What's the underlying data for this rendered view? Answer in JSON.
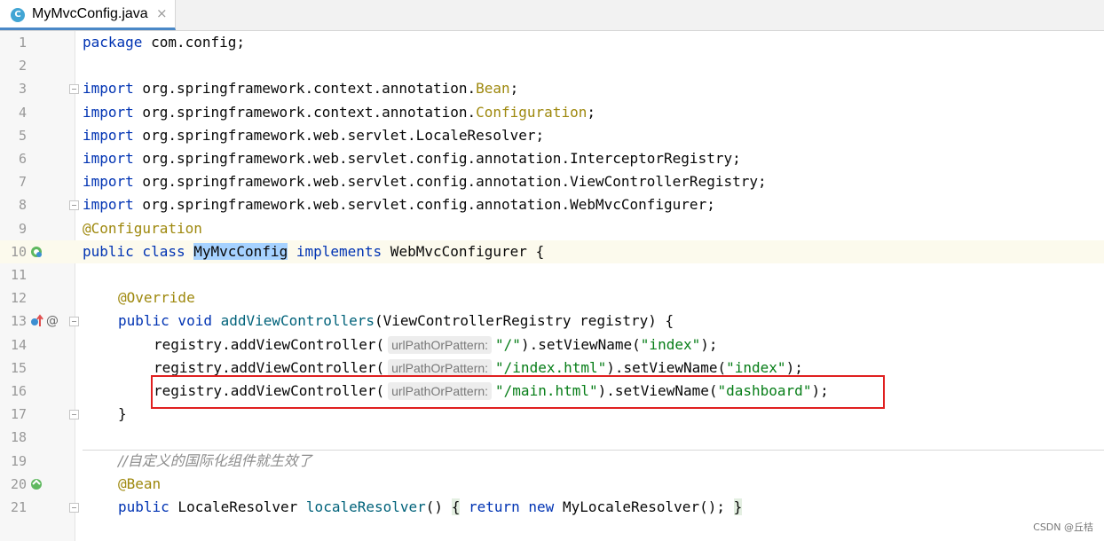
{
  "tab": {
    "icon_letter": "C",
    "title": "MyMvcConfig.java",
    "close_glyph": "×"
  },
  "lines": [
    {
      "n": "1"
    },
    {
      "n": "2"
    },
    {
      "n": "3"
    },
    {
      "n": "4"
    },
    {
      "n": "5"
    },
    {
      "n": "6"
    },
    {
      "n": "7"
    },
    {
      "n": "8"
    },
    {
      "n": "9"
    },
    {
      "n": "10"
    },
    {
      "n": "11"
    },
    {
      "n": "12"
    },
    {
      "n": "13"
    },
    {
      "n": "14"
    },
    {
      "n": "15"
    },
    {
      "n": "16"
    },
    {
      "n": "17"
    },
    {
      "n": "18"
    },
    {
      "n": "19"
    },
    {
      "n": "20"
    },
    {
      "n": "21"
    }
  ],
  "code": {
    "l1": {
      "kw": "package",
      "rest": " com.config;"
    },
    "l3": {
      "kw": "import",
      "pkg": " org.springframework.context.annotation.",
      "cls": "Bean",
      "end": ";"
    },
    "l4": {
      "kw": "import",
      "pkg": " org.springframework.context.annotation.",
      "cls": "Configuration",
      "end": ";"
    },
    "l5": {
      "kw": "import",
      "rest": " org.springframework.web.servlet.LocaleResolver;"
    },
    "l6": {
      "kw": "import",
      "rest": " org.springframework.web.servlet.config.annotation.InterceptorRegistry;"
    },
    "l7": {
      "kw": "import",
      "rest": " org.springframework.web.servlet.config.annotation.ViewControllerRegistry;"
    },
    "l8": {
      "kw": "import",
      "rest": " org.springframework.web.servlet.config.annotation.WebMvcConfigurer;"
    },
    "l9": {
      "ann": "@Configuration"
    },
    "l10": {
      "kw1": "public class ",
      "cls": "MyMvcConfig",
      "kw2": " implements",
      "rest": " WebMvcConfigurer {"
    },
    "l12": {
      "ann": "@Override"
    },
    "l13": {
      "kw": "public void ",
      "fn": "addViewControllers",
      "rest": "(ViewControllerRegistry registry) {"
    },
    "l14": {
      "pre": "registry.addViewController(",
      "hint": "urlPathOrPattern:",
      "str1": "\"/\"",
      "mid": ").setViewName(",
      "str2": "\"index\"",
      "end": ");"
    },
    "l15": {
      "pre": "registry.addViewController(",
      "hint": "urlPathOrPattern:",
      "str1": "\"/index.html\"",
      "mid": ").setViewName(",
      "str2": "\"index\"",
      "end": ");"
    },
    "l16": {
      "pre": "registry.addViewController(",
      "hint": "urlPathOrPattern:",
      "str1": "\"/main.html\"",
      "mid": ").setViewName(",
      "str2": "\"dashboard\"",
      "end": ");"
    },
    "l17": {
      "rest": "}"
    },
    "l19": {
      "cmt": "//自定义的国际化组件就生效了"
    },
    "l20": {
      "ann": "@Bean"
    },
    "l21": {
      "kw1": "public",
      "type": " LocaleResolver ",
      "fn": "localeResolver",
      "paren": "()",
      "brace_open": "{",
      "kw2": "return",
      "kw3": "new",
      "ctor": " MyLocaleResolver();",
      "brace_close": "}"
    }
  },
  "gutter_icons": {
    "l10": "bean-class-icon",
    "l13": "override-marker-icon",
    "l13_at": "@",
    "l20": "bean-method-icon"
  },
  "watermark": "CSDN @丘桔",
  "colors": {
    "keyword": "#0033b3",
    "annotation": "#9e880d",
    "string": "#067d17",
    "comment": "#8c8c8c",
    "highlight_box": "#e02020",
    "selection": "#a6d2ff"
  }
}
